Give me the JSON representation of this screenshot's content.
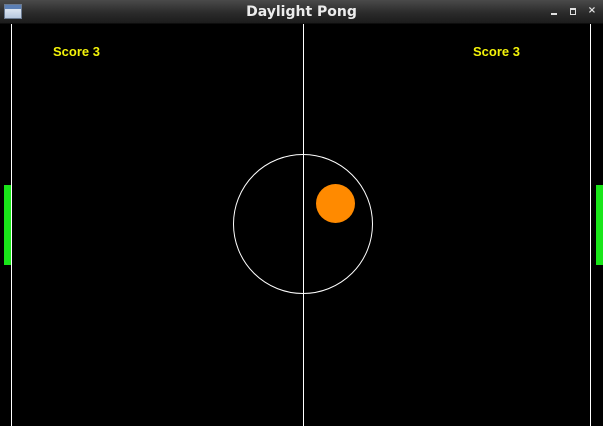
{
  "window": {
    "title": "Daylight Pong",
    "controls": {
      "minimize_icon": "minimize-icon",
      "maximize_icon": "maximize-icon",
      "close_label": "×"
    }
  },
  "scores": {
    "left": "Score 3",
    "right": "Score 3"
  },
  "colors": {
    "background": "#000000",
    "lines": "#ffffff",
    "score_text": "#f2f20a",
    "paddle": "#19e619",
    "ball": "#ff8a00"
  }
}
